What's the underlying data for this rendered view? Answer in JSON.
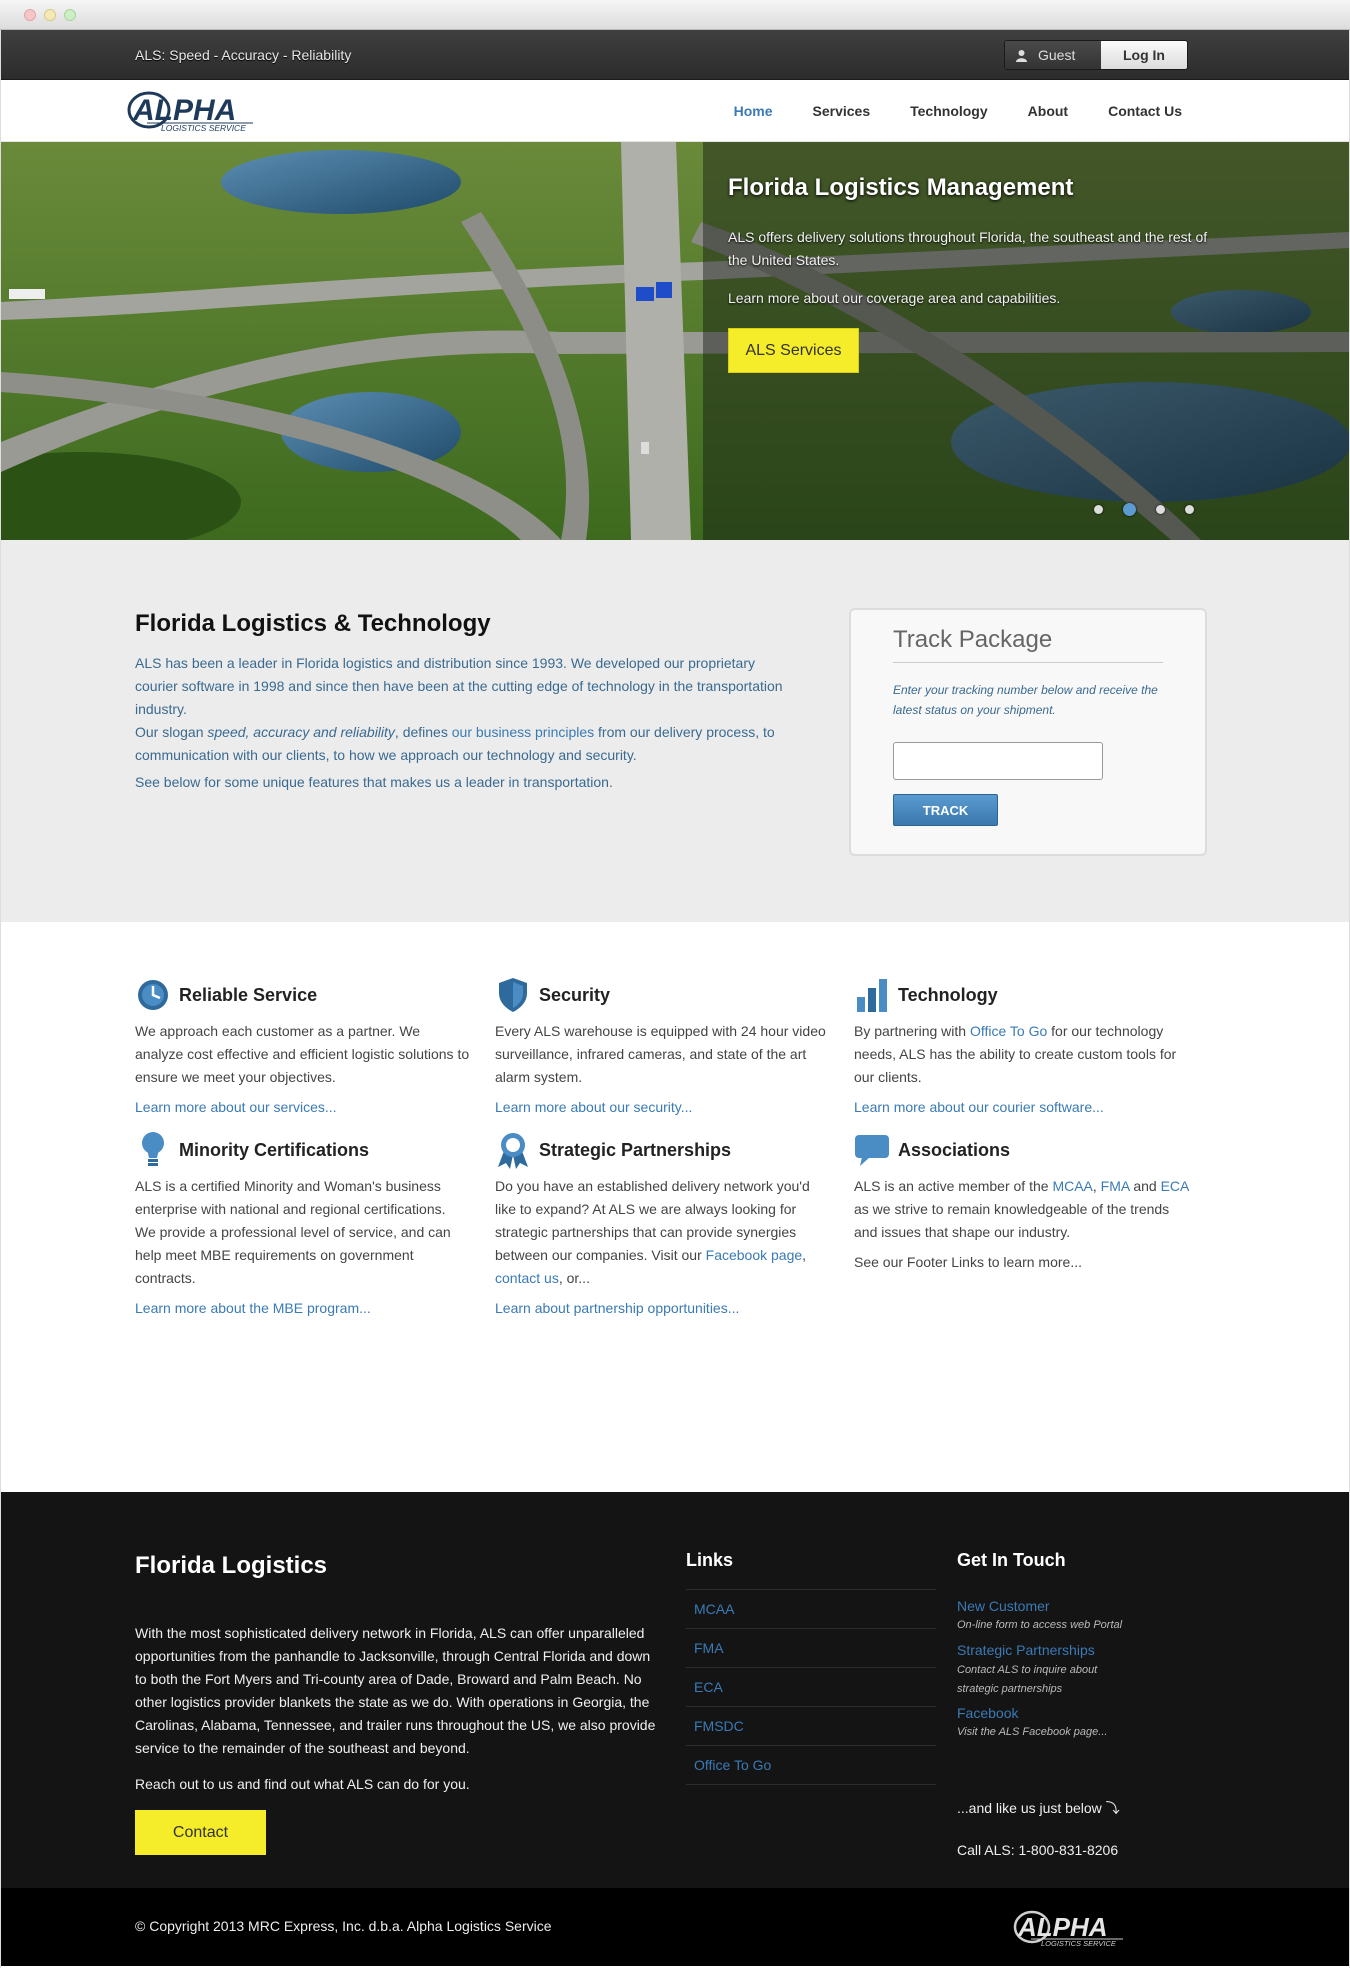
{
  "topbar": {
    "slogan": "ALS: Speed - Accuracy - Reliability",
    "guest_label": "Guest",
    "login_label": "Log In"
  },
  "brand": {
    "logo_text": "ALPHA",
    "logo_subtext": "LOGISTICS SERVICE"
  },
  "nav": {
    "items": [
      "Home",
      "Services",
      "Technology",
      "About",
      "Contact Us"
    ],
    "active": "Home"
  },
  "hero": {
    "title": "Florida Logistics Management",
    "text1": "ALS offers delivery solutions throughout Florida, the southeast and the rest of the United States.",
    "text2": "Learn more about our coverage area and capabilities.",
    "button": "ALS Services",
    "slide_count": 4,
    "active_slide": 2
  },
  "intro": {
    "title": "Florida Logistics & Technology",
    "p1": "ALS has been a leader in Florida logistics and distribution since 1993. We developed our proprietary courier software in 1998 and since then have been at the cutting edge of technology in the transportation industry.",
    "p2_a": "Our slogan ",
    "p2_em": "speed, accuracy and reliability",
    "p2_b": ", defines ",
    "p2_link": "our business principles",
    "p2_c": " from our delivery process, to communication with our clients, to how we approach our technology and security.",
    "p3": "See below for some unique features that makes us a leader in transportation."
  },
  "track": {
    "title": "Track Package",
    "desc": "Enter your tracking number below and receive the latest status on your shipment.",
    "input_value": "",
    "button": "TRACK"
  },
  "features": {
    "reliable": {
      "title": "Reliable Service",
      "icon": "clock-icon",
      "body": "We approach each customer as a partner. We analyze cost effective and efficient logistic solutions to ensure we meet your objectives.",
      "more": "Learn more about our services..."
    },
    "security": {
      "title": "Security",
      "icon": "shield-icon",
      "body": "Every ALS warehouse is equipped with 24 hour video surveillance, infrared cameras, and state of the art alarm system.",
      "more": "Learn more about our security..."
    },
    "technology": {
      "title": "Technology",
      "icon": "bar-chart-icon",
      "body_a": "By partnering with ",
      "body_link": "Office To Go",
      "body_b": " for our technology needs, ALS has the ability to create custom tools for our clients.",
      "more": "Learn more about our courier software..."
    },
    "minority": {
      "title": "Minority Certifications",
      "icon": "lightbulb-icon",
      "body": "ALS is a certified Minority and Woman's business enterprise with national and regional certifications. We provide a professional level of service, and can help meet MBE requirements on government contracts.",
      "more": "Learn more about the MBE program..."
    },
    "partnerships": {
      "title": "Strategic Partnerships",
      "icon": "ribbon-icon",
      "body_a": "Do you have an established delivery network you'd like to expand? At ALS we are always looking for strategic partnerships that can provide synergies between our companies. Visit our ",
      "body_link1": "Facebook page",
      "body_b": ", ",
      "body_link2": "contact us",
      "body_c": ", or...",
      "more": "Learn about partnership opportunities..."
    },
    "associations": {
      "title": "Associations",
      "icon": "speech-bubble-icon",
      "body_a": "ALS is an active member of the ",
      "link1": "MCAA",
      "sep1": ", ",
      "link2": "FMA",
      "sep2": " and ",
      "link3": "ECA",
      "body_b": " as we strive to remain knowledgeable of the trends and issues that shape our industry.",
      "more": "See our Footer Links to learn more..."
    }
  },
  "footer": {
    "title": "Florida Logistics",
    "body": "With the most sophisticated delivery network in Florida, ALS can offer unparalleled opportunities from the panhandle to Jacksonville, through Central Florida and down to both the Fort Myers and Tri-county area of Dade, Broward and Palm Beach. No other logistics provider blankets the state as we do. With operations in Georgia, the Carolinas, Alabama, Tennessee, and trailer runs throughout the US, we also provide service to the remainder of the southeast and beyond.",
    "reach": "Reach out to us and find out what ALS can do for you.",
    "contact_button": "Contact",
    "links_title": "Links",
    "links": [
      "MCAA",
      "FMA",
      "ECA",
      "FMSDC",
      "Office To Go"
    ],
    "git_title": "Get In Touch",
    "git_items": [
      {
        "link": "New Customer",
        "desc": "On-line form to access web Portal"
      },
      {
        "link": "Strategic Partnerships",
        "desc": "Contact ALS to inquire about strategic partnerships"
      },
      {
        "link": "Facebook",
        "desc": "Visit the ALS Facebook page..."
      }
    ],
    "like_text": "...and like us just below ⤵",
    "call_text": "Call ALS: 1-800-831-8206",
    "copyright": "© Copyright 2013 MRC Express, Inc. d.b.a. Alpha Logistics Service"
  },
  "colors": {
    "accent_blue": "#3a7ab5",
    "button_yellow": "#f5ec2a",
    "footer_bg": "#141414"
  }
}
